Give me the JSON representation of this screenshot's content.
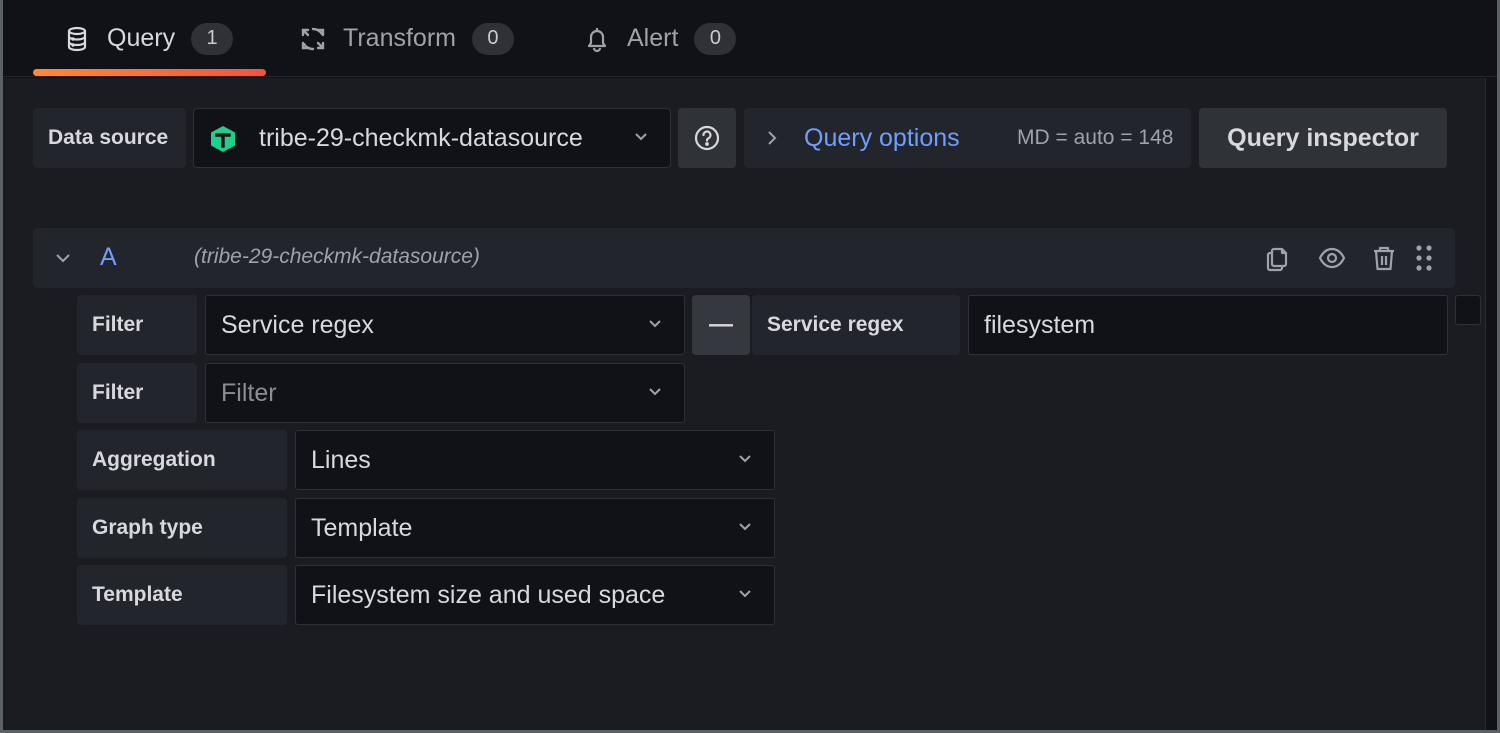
{
  "tabs": [
    {
      "label": "Query",
      "count": "1",
      "icon": "database-icon",
      "active": true
    },
    {
      "label": "Transform",
      "count": "0",
      "icon": "transform-icon",
      "active": false
    },
    {
      "label": "Alert",
      "count": "0",
      "icon": "bell-icon",
      "active": false
    }
  ],
  "toolbar": {
    "datasource_label": "Data source",
    "datasource_value": "tribe-29-checkmk-datasource",
    "help_icon": "question-circle-icon",
    "query_options_label": "Query options",
    "query_options_summary": "MD = auto = 148",
    "query_inspector_label": "Query inspector"
  },
  "query": {
    "ref_id": "A",
    "datasource_hint": "(tribe-29-checkmk-datasource)",
    "actions": [
      "duplicate-icon",
      "eye-icon",
      "trash-icon",
      "drag-handle-icon"
    ],
    "filters": [
      {
        "label": "Filter",
        "value": "Service regex",
        "remove_label": "—",
        "param_label": "Service regex",
        "param_value": "filesystem"
      },
      {
        "label": "Filter",
        "placeholder": "Filter"
      }
    ],
    "aggregation": {
      "label": "Aggregation",
      "value": "Lines"
    },
    "graph_type": {
      "label": "Graph type",
      "value": "Template"
    },
    "template": {
      "label": "Template",
      "value": "Filesystem size and used space"
    }
  },
  "colors": {
    "accent_gradient_start": "#ff8a30",
    "accent_gradient_end": "#f4533f",
    "link_blue": "#6e9fff",
    "datasource_logo": "#1dd08c"
  }
}
